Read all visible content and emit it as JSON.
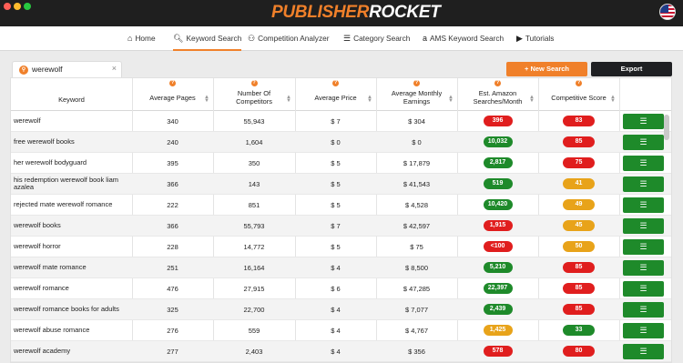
{
  "app": {
    "logo_part1": "PUBLISHER",
    "logo_part2": "ROCKET"
  },
  "nav": {
    "items": [
      {
        "label": "Home",
        "icon": "home-icon"
      },
      {
        "label": "Keyword Search",
        "icon": "search-icon",
        "active": true
      },
      {
        "label": "Competition Analyzer",
        "icon": "people-icon"
      },
      {
        "label": "Category Search",
        "icon": "list-icon"
      },
      {
        "label": "AMS Keyword Search",
        "icon": "amazon-icon"
      },
      {
        "label": "Tutorials",
        "icon": "play-icon"
      }
    ]
  },
  "tab": {
    "label": "werewolf",
    "close": "×"
  },
  "actions": {
    "new_search": "+ New Search",
    "export": "Export"
  },
  "table": {
    "headers": {
      "keyword": "Keyword",
      "avg_pages": "Average Pages",
      "competitors": "Number Of Competitors",
      "avg_price": "Average Price",
      "earnings": "Average Monthly Earnings",
      "searches": "Est. Amazon Searches/Month",
      "score": "Competitive Score"
    },
    "rows": [
      {
        "keyword": "werewolf",
        "pages": "340",
        "competitors": "55,943",
        "price": "$ 7",
        "earnings": "$ 304",
        "searches": "396",
        "searches_color": "red",
        "score": "83",
        "score_color": "red"
      },
      {
        "keyword": "free werewolf books",
        "pages": "240",
        "competitors": "1,604",
        "price": "$ 0",
        "earnings": "$ 0",
        "searches": "10,032",
        "searches_color": "green",
        "score": "85",
        "score_color": "red"
      },
      {
        "keyword": "her werewolf bodyguard",
        "pages": "395",
        "competitors": "350",
        "price": "$ 5",
        "earnings": "$ 17,879",
        "searches": "2,817",
        "searches_color": "green",
        "score": "75",
        "score_color": "red"
      },
      {
        "keyword": "his redemption werewolf book liam azalea",
        "pages": "366",
        "competitors": "143",
        "price": "$ 5",
        "earnings": "$ 41,543",
        "searches": "519",
        "searches_color": "green",
        "score": "41",
        "score_color": "orange"
      },
      {
        "keyword": "rejected mate werewolf romance",
        "pages": "222",
        "competitors": "851",
        "price": "$ 5",
        "earnings": "$ 4,528",
        "searches": "10,420",
        "searches_color": "green",
        "score": "49",
        "score_color": "orange"
      },
      {
        "keyword": "werewolf books",
        "pages": "366",
        "competitors": "55,793",
        "price": "$ 7",
        "earnings": "$ 42,597",
        "searches": "1,915",
        "searches_color": "red",
        "score": "45",
        "score_color": "orange"
      },
      {
        "keyword": "werewolf horror",
        "pages": "228",
        "competitors": "14,772",
        "price": "$ 5",
        "earnings": "$ 75",
        "searches": "<100",
        "searches_color": "red",
        "score": "50",
        "score_color": "orange"
      },
      {
        "keyword": "werewolf mate romance",
        "pages": "251",
        "competitors": "16,164",
        "price": "$ 4",
        "earnings": "$ 8,500",
        "searches": "5,210",
        "searches_color": "green",
        "score": "85",
        "score_color": "red"
      },
      {
        "keyword": "werewolf romance",
        "pages": "476",
        "competitors": "27,915",
        "price": "$ 6",
        "earnings": "$ 47,285",
        "searches": "22,397",
        "searches_color": "green",
        "score": "85",
        "score_color": "red"
      },
      {
        "keyword": "werewolf romance books for adults",
        "pages": "325",
        "competitors": "22,700",
        "price": "$ 4",
        "earnings": "$ 7,077",
        "searches": "2,439",
        "searches_color": "green",
        "score": "85",
        "score_color": "red"
      },
      {
        "keyword": "werewolf abuse romance",
        "pages": "276",
        "competitors": "559",
        "price": "$ 4",
        "earnings": "$ 4,767",
        "searches": "1,425",
        "searches_color": "orange",
        "score": "33",
        "score_color": "green"
      },
      {
        "keyword": "werewolf academy",
        "pages": "277",
        "competitors": "2,403",
        "price": "$ 4",
        "earnings": "$ 356",
        "searches": "578",
        "searches_color": "red",
        "score": "80",
        "score_color": "red"
      }
    ]
  },
  "icons": {
    "tab_badge": "search-badge-icon",
    "row_action": "list-icon",
    "help": "question-icon"
  }
}
